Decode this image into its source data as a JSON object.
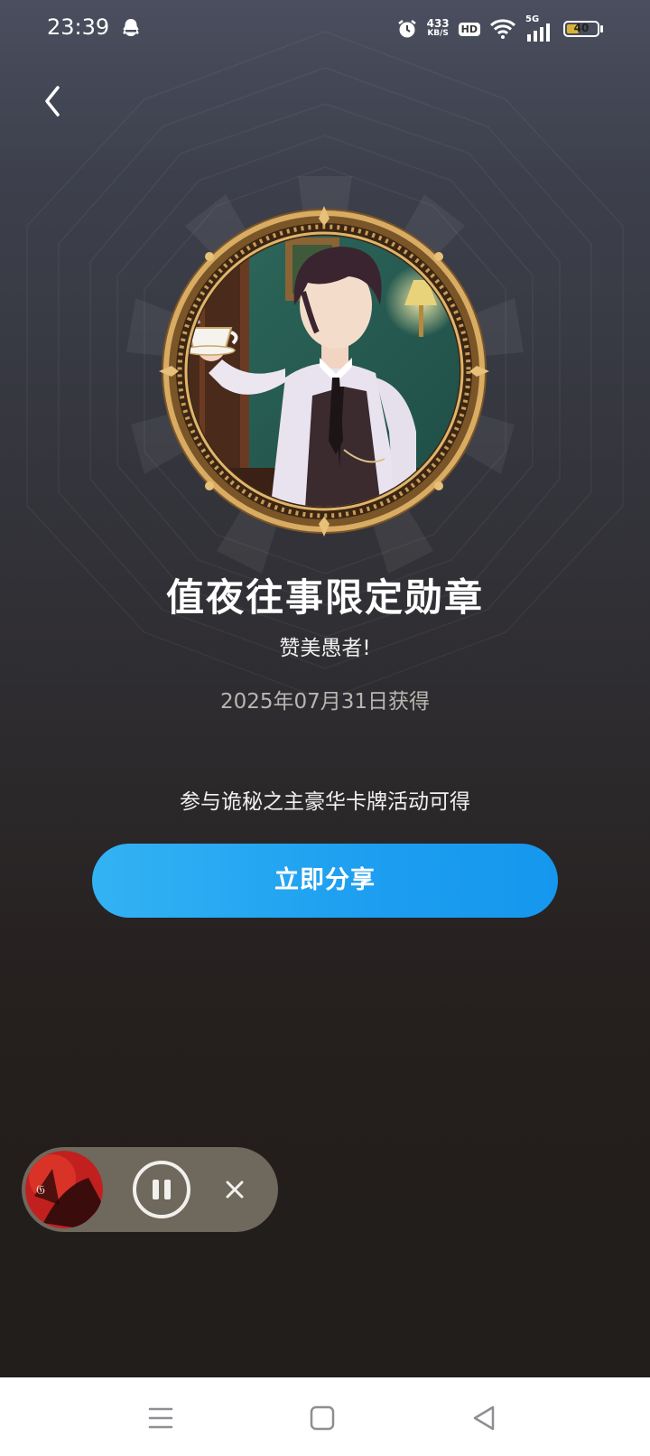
{
  "status_bar": {
    "time": "23:39",
    "network_speed": "433",
    "network_speed_unit": "KB/S",
    "hd_label": "HD",
    "network_type": "5G",
    "battery_level": "40",
    "icons": [
      "notification-app-icon",
      "alarm-icon",
      "wifi-icon",
      "signal-icon",
      "battery-icon"
    ]
  },
  "header": {
    "back_icon": "chevron-left-icon"
  },
  "medal": {
    "title": "值夜往事限定勋章",
    "subtitle": "赞美愚者!",
    "obtained_date": "2025年07月31日获得",
    "obtain_hint": "参与诡秘之主豪华卡牌活动可得",
    "frame_color": "#b88a4a"
  },
  "share_button": {
    "label": "立即分享",
    "color": "#1d9ef0"
  },
  "mini_player": {
    "state": "playing",
    "pause_icon": "pause-icon",
    "close_icon": "close-icon"
  },
  "nav_bar": {
    "items": [
      "menu-icon",
      "home-square-icon",
      "back-triangle-icon"
    ]
  }
}
